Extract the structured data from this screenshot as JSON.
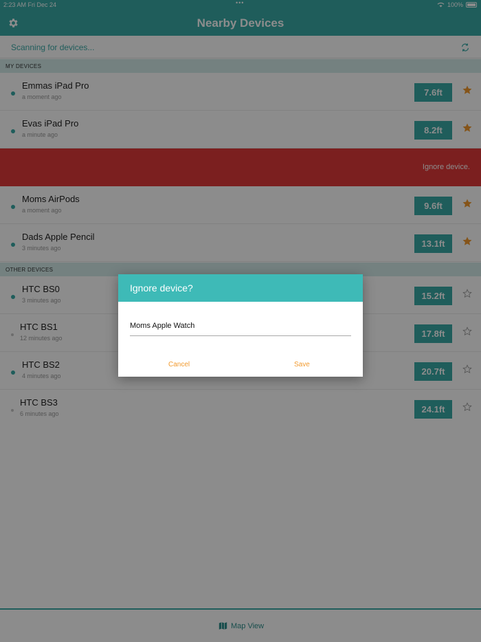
{
  "status_bar": {
    "time": "2:23 AM",
    "date": "Fri Dec 24",
    "battery": "100%"
  },
  "nav": {
    "title": "Nearby Devices"
  },
  "scan": {
    "text": "Scanning for devices..."
  },
  "sections": {
    "my_devices": "MY DEVICES",
    "other_devices": "OTHER DEVICES"
  },
  "my_devices": [
    {
      "name": "Emmas iPad Pro",
      "time": "a moment ago",
      "distance": "7.6ft",
      "favorite": true,
      "active": true
    },
    {
      "name": "Evas iPad Pro",
      "time": "a minute ago",
      "distance": "8.2ft",
      "favorite": true,
      "active": true
    },
    {
      "name": "Moms AirPods",
      "time": "a moment ago",
      "distance": "9.6ft",
      "favorite": true,
      "active": true
    },
    {
      "name": "Dads Apple Pencil",
      "time": "3 minutes ago",
      "distance": "13.1ft",
      "favorite": true,
      "active": true
    }
  ],
  "swipe_action": {
    "label": "Ignore device."
  },
  "other_devices": [
    {
      "name": "HTC BS0",
      "time": "3 minutes ago",
      "distance": "15.2ft",
      "favorite": false,
      "active": true
    },
    {
      "name": "HTC BS1",
      "time": "12 minutes ago",
      "distance": "17.8ft",
      "favorite": false,
      "active": false
    },
    {
      "name": "HTC BS2",
      "time": "4 minutes ago",
      "distance": "20.7ft",
      "favorite": false,
      "active": true
    },
    {
      "name": "HTC BS3",
      "time": "6 minutes ago",
      "distance": "24.1ft",
      "favorite": false,
      "active": false
    }
  ],
  "bottom": {
    "map_view_label": "Map View"
  },
  "dialog": {
    "title": "Ignore device?",
    "input_value": "Moms Apple Watch",
    "cancel_label": "Cancel",
    "save_label": "Save"
  },
  "colors": {
    "accent": "#3aaaa7",
    "destructive": "#e03a3a",
    "star": "#f29a2e",
    "dialog_button": "#f29a2e"
  },
  "icons": {
    "settings": "gear-icon",
    "refresh": "refresh-icon",
    "favorite": "star-icon",
    "map": "map-icon"
  }
}
